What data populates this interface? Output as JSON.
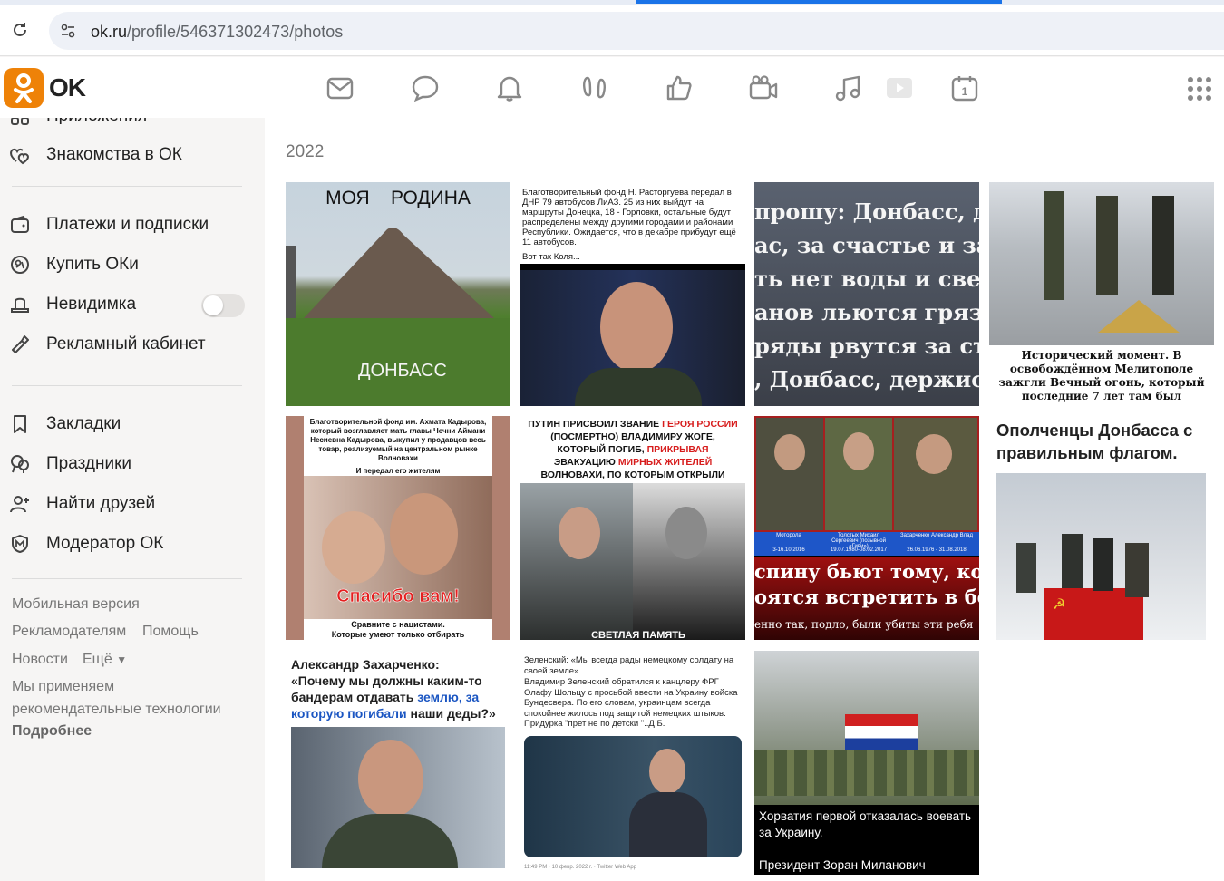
{
  "browser": {
    "url_host": "ok.ru",
    "url_path": "/profile/546371302473/photos"
  },
  "header": {
    "logo_text": "OK",
    "nav_icons": [
      "mail-icon",
      "chat-icon",
      "bell-icon",
      "guests-icon",
      "like-icon",
      "video-camera-icon",
      "music-icon",
      "video-play-icon",
      "calendar-icon",
      "apps-grid-icon"
    ],
    "calendar_day": "1"
  },
  "sidebar": {
    "partial_item": "Приложения",
    "items": [
      {
        "label": "Знакомства в ОК",
        "icon": "hearts-icon"
      },
      {
        "label": "Платежи и подписки",
        "icon": "wallet-icon"
      },
      {
        "label": "Купить ОКи",
        "icon": "coin-icon"
      },
      {
        "label": "Невидимка",
        "icon": "invisible-hat-icon",
        "toggle": false
      },
      {
        "label": "Рекламный кабинет",
        "icon": "megaphone-icon"
      },
      {
        "label": "Закладки",
        "icon": "bookmark-icon"
      },
      {
        "label": "Праздники",
        "icon": "balloons-icon"
      },
      {
        "label": "Найти друзей",
        "icon": "add-friend-icon"
      },
      {
        "label": "Модератор ОК",
        "icon": "moderator-shield-icon"
      }
    ],
    "footer": {
      "mobile": "Мобильная версия",
      "advertisers": "Рекламодателям",
      "help": "Помощь",
      "news": "Новости",
      "more": "Ещё",
      "tech_note_1": "Мы применяем",
      "tech_note_2": "рекомендательные технологии",
      "more_details": "Подробнее"
    }
  },
  "main": {
    "year": "2022",
    "photos": [
      {
        "caption_top": "МОЯ    РОДИНА",
        "caption_bottom": "ДОНБАСС"
      },
      {
        "text": "Благотворительный фонд Н. Расторгуева передал в ДНР 79 автобусов ЛиАЗ. 25 из них выйдут на маршруты Донецка, 18 - Горловки, остальные будут распределены между другими городами и районами Республики. Ожидается, что в декабре прибудут ещё 11 автобусов.",
        "text2": "Вот так Коля..."
      },
      {
        "lines": [
          "прошу: Донбасс, держ",
          "ас, за счастье и за жи",
          "ть нет воды и света н",
          "анов льются грязь и",
          "ряды рвутся за стено",
          ", Донбасс, держись, р"
        ]
      },
      {
        "caption": "Исторический момент. В освобождённом Мелитополе зажгли Вечный огонь, который последние 7 лет там был"
      },
      {
        "text": "Благотворительной фонд им. Ахмата Кадырова, который возглавляет мать главы Чечни Аймани Несиевна Кадырова, выкупил у продавцов весь товар, реализуемый на центральном рынке Волновахи",
        "text2": "И передал его жителям",
        "thanks": "Спасибо вам!",
        "bottom1": "Сравните с нацистами.",
        "bottom2": "Которые умеют только отбирать"
      },
      {
        "part1": "ПУТИН ПРИСВОИЛ ЗВАНИЕ ",
        "part2": "ГЕРОЯ РОССИИ",
        "part3": " (ПОСМЕРТНО) ВЛАДИМИРУ ЖОГЕ, КОТОРЫЙ ПОГИБ, ",
        "part4": "ПРИКРЫВАЯ",
        "part5": " ЭВАКУАЦИЮ ",
        "part6": "МИРНЫХ ЖИТЕЛЕЙ",
        "part7": " ВОЛНОВАХИ, ПО КОТОРЫМ ОТКРЫЛИ ОГОНЬ НАЦИОНАЛИСТЫ...",
        "bottom": "СВЕТЛАЯ ПАМЯТЬ"
      },
      {
        "names": [
          "Моторола",
          "Толстых Михаил Сергеевич (позывной «Гиви»)",
          "Захарченко Александр Влад"
        ],
        "dates": [
          "3-16.10.2016",
          "19.07.1980-08.02.2017",
          "26.06.1976 - 31.08.2018"
        ],
        "line1": "спину бьют тому, ко",
        "line2": "оятся встретить в бо",
        "line3": "енно так, подло, были убиты эти ребя"
      },
      {
        "caption": "Ополченцы Донбасса с правильным флагом."
      },
      {
        "t1": "Александр Захарченко:",
        "t2": "«Почему мы должны каким-то бандерам отдавать ",
        "t3": "землю, за которую погибали",
        "t4": " наши деды?»"
      },
      {
        "text": "Зеленский: «Мы всегда рады немецкому солдату на своей земле».",
        "text2": "Владимир Зеленский обратился к канцлеру ФРГ Олафу Шольцу с просьбой ввести на Украину войска Бундесвера. По его словам, украинцам всегда спокойнее жилось под защитой немецких штыков.",
        "text3": "Придурка \"прет не по детски \"..Д Б.",
        "footer": "11:49 PM · 10 февр. 2022 г. · Twitter Web App"
      },
      {
        "cap1": "Хорватия первой отказалась воевать за Украину.",
        "cap2": "Президент Зоран Миланович"
      }
    ]
  }
}
